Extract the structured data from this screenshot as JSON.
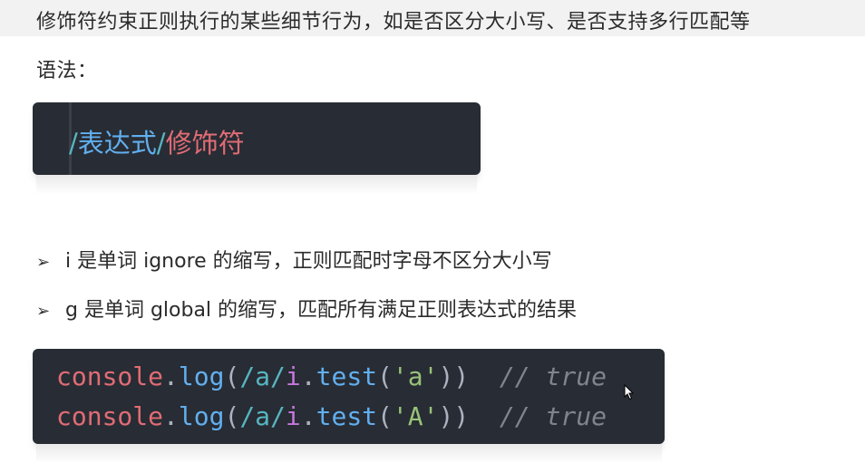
{
  "intro": {
    "line1": "修饰符约束正则执行的某些细节行为，如是否区分大小写、是否支持多行匹配等",
    "line2": "语法："
  },
  "syntax_block": {
    "slash1": "/",
    "expression": "表达式",
    "slash2": "/",
    "modifier": "修饰符"
  },
  "bullets": [
    {
      "marker": "➢",
      "text": "i 是单词 ignore 的缩写，正则匹配时字母不区分大小写"
    },
    {
      "marker": "➢",
      "text": "g 是单词 global 的缩写，匹配所有满足正则表达式的结果"
    }
  ],
  "example_block": {
    "lines": [
      {
        "obj": "console",
        "dot": ".",
        "fn": "log",
        "open": "(",
        "regex": "/a/",
        "flag": "i",
        "dot2": ".",
        "method": "test",
        "open2": "(",
        "arg": "'a'",
        "close": "))",
        "comment": "// true"
      },
      {
        "obj": "console",
        "dot": ".",
        "fn": "log",
        "open": "(",
        "regex": "/a/",
        "flag": "i",
        "dot2": ".",
        "method": "test",
        "open2": "(",
        "arg": "'A'",
        "close": "))",
        "comment": "// true"
      }
    ]
  },
  "colors": {
    "code_bg": "#282c34",
    "regex": "#56b6c2",
    "keyword_red": "#e06c75",
    "function_blue": "#61afef",
    "flag_purple": "#c678dd",
    "string_green": "#98c379",
    "comment_gray": "#7f848e"
  },
  "icons": {
    "bullet": "arrow-bullet-icon",
    "pointer": "mouse-cursor-icon"
  }
}
